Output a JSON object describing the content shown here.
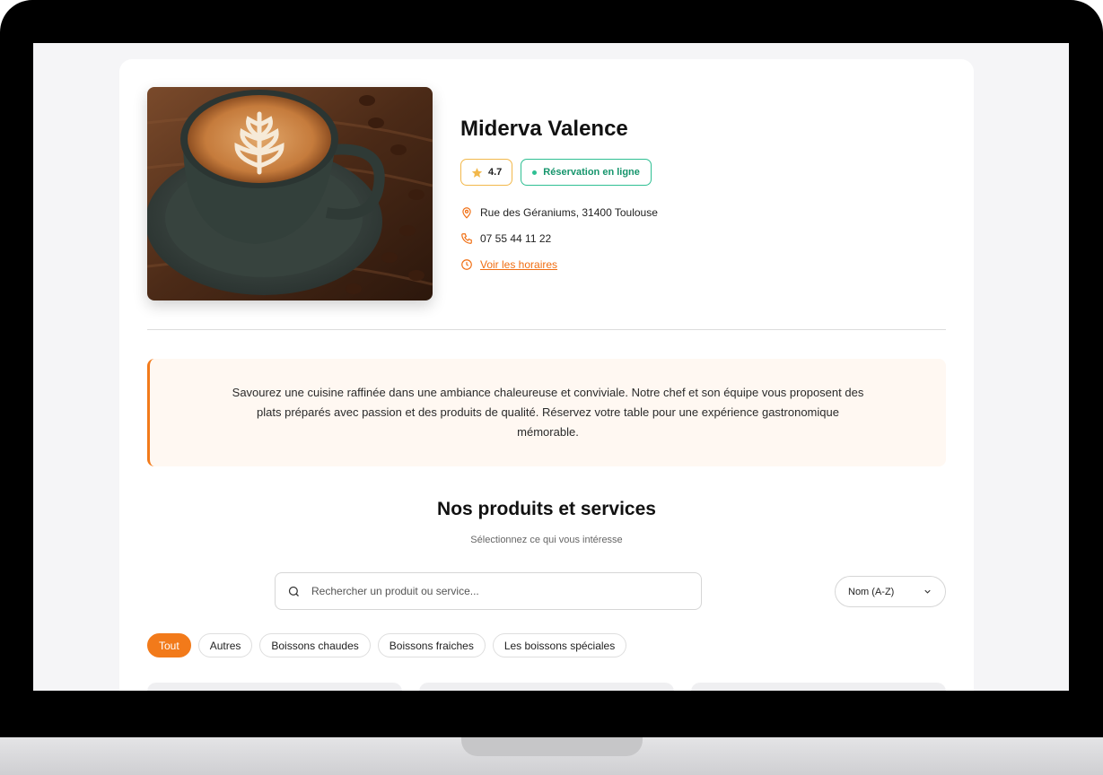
{
  "business": {
    "name": "Miderva Valence",
    "rating": "4.7",
    "reservation_badge": "Réservation en ligne",
    "address": "Rue des Géraniums, 31400 Toulouse",
    "phone": "07 55 44 11 22",
    "hours_link": "Voir les horaires"
  },
  "description": "Savourez une cuisine raffinée dans une ambiance chaleureuse et conviviale. Notre chef et son équipe vous proposent des plats préparés avec passion et des produits de qualité. Réservez votre table pour une expérience gastronomique mémorable.",
  "products": {
    "title": "Nos produits et services",
    "subtitle": "Sélectionnez ce qui vous intéresse",
    "search_placeholder": "Rechercher un produit ou service...",
    "sort_selected": "Nom (A-Z)",
    "categories": [
      "Tout",
      "Autres",
      "Boissons chaudes",
      "Boissons fraiches",
      "Les boissons spéciales"
    ],
    "active_category": "Tout"
  },
  "colors": {
    "accent": "#f27a1a",
    "star": "#f2b84b",
    "success": "#2fbf93"
  },
  "icons": [
    "star-icon",
    "map-pin-icon",
    "phone-icon",
    "clock-icon",
    "search-icon",
    "chevron-down-icon"
  ]
}
